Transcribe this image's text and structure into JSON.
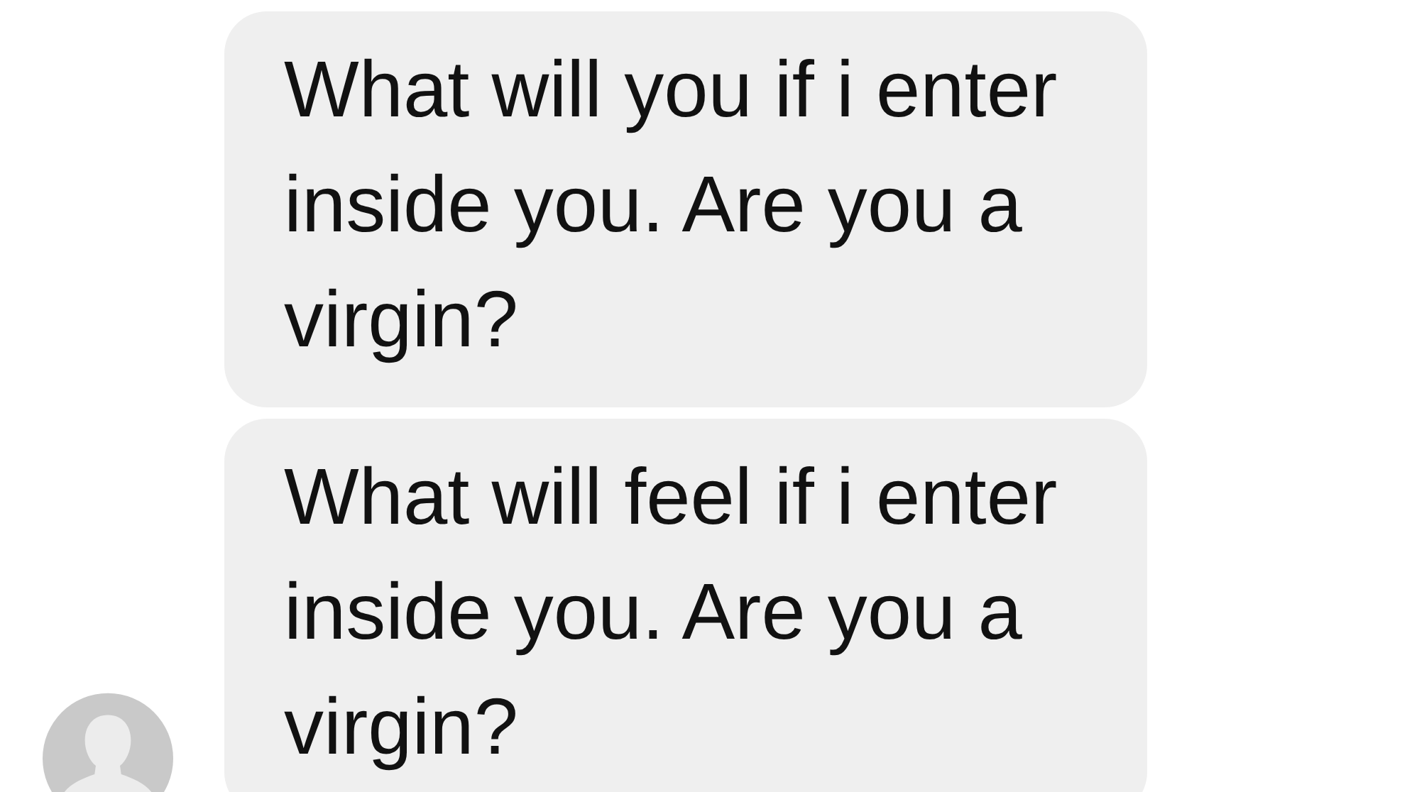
{
  "messages": [
    {
      "text": "What will you if i enter inside you. Are you a virgin?",
      "avatar": false
    },
    {
      "text": "What will feel if i enter inside you. Are you a virgin?",
      "avatar": true
    }
  ]
}
